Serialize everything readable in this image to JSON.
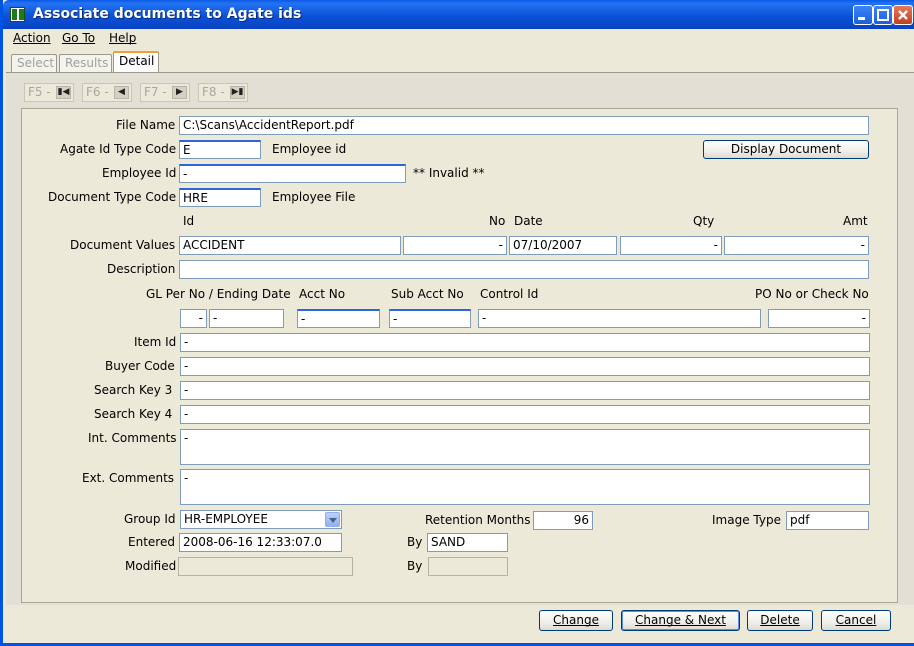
{
  "window": {
    "title": "Associate documents to Agate ids",
    "min_icon": "minimize-icon",
    "max_icon": "maximize-icon",
    "close_icon": "close-icon"
  },
  "menu": {
    "action": "Action",
    "goto": "Go To",
    "help": "Help"
  },
  "tabs": {
    "select": "Select",
    "results": "Results",
    "detail": "Detail",
    "active": "Detail"
  },
  "nav": {
    "f5": "F5 -",
    "f6": "F6 -",
    "f7": "F7 -",
    "f8": "F8 -",
    "f5_icon": "first-record-icon",
    "f6_icon": "previous-record-icon",
    "f7_icon": "next-record-icon",
    "f8_icon": "last-record-icon"
  },
  "form": {
    "file_name_label": "File Name",
    "file_name": "C:\\Scans\\AccidentReport.pdf",
    "agate_type_label": "Agate Id Type Code",
    "agate_type": "E",
    "agate_type_desc": "Employee id",
    "display_doc": "Display Document",
    "employee_id_label": "Employee Id",
    "employee_id": "-",
    "invalid_note": "** Invalid **",
    "doc_type_label": "Document Type Code",
    "doc_type": "HRE",
    "doc_type_desc": "Employee File",
    "col_id": "Id",
    "col_no": "No",
    "col_date": "Date",
    "col_qty": "Qty",
    "col_amt": "Amt",
    "doc_values_label": "Document Values",
    "doc_id": "ACCIDENT",
    "doc_no": "-",
    "doc_date": "07/10/2007",
    "doc_qty": "-",
    "doc_amt": "-",
    "description_label": "Description",
    "description": "",
    "gl_label": "GL Per No / Ending Date",
    "acct_label": "Acct No",
    "subacct_label": "Sub Acct No",
    "control_label": "Control Id",
    "po_label": "PO No or Check No",
    "gl_per": "-",
    "gl_end": "-",
    "acct": "-",
    "subacct": "-",
    "control": "-",
    "po": "-",
    "item_label": "Item Id",
    "item": "-",
    "buyer_label": "Buyer Code",
    "buyer": "-",
    "sk3_label": "Search Key 3",
    "sk3": "-",
    "sk4_label": "Search Key 4",
    "sk4": "-",
    "int_label": "Int. Comments",
    "int_comments": "-",
    "ext_label": "Ext. Comments",
    "ext_comments": "-",
    "group_label": "Group Id",
    "group": "HR-EMPLOYEE",
    "retention_label": "Retention Months",
    "retention": "96",
    "image_type_label": "Image Type",
    "image_type": "pdf",
    "entered_label": "Entered",
    "entered": "2008-06-16 12:33:07.0",
    "entered_by_label": "By",
    "entered_by": "SAND",
    "modified_label": "Modified",
    "modified": "",
    "modified_by_label": "By",
    "modified_by": ""
  },
  "buttons": {
    "change": "Change",
    "change_next": "Change & Next",
    "delete": "Delete",
    "cancel": "Cancel"
  }
}
